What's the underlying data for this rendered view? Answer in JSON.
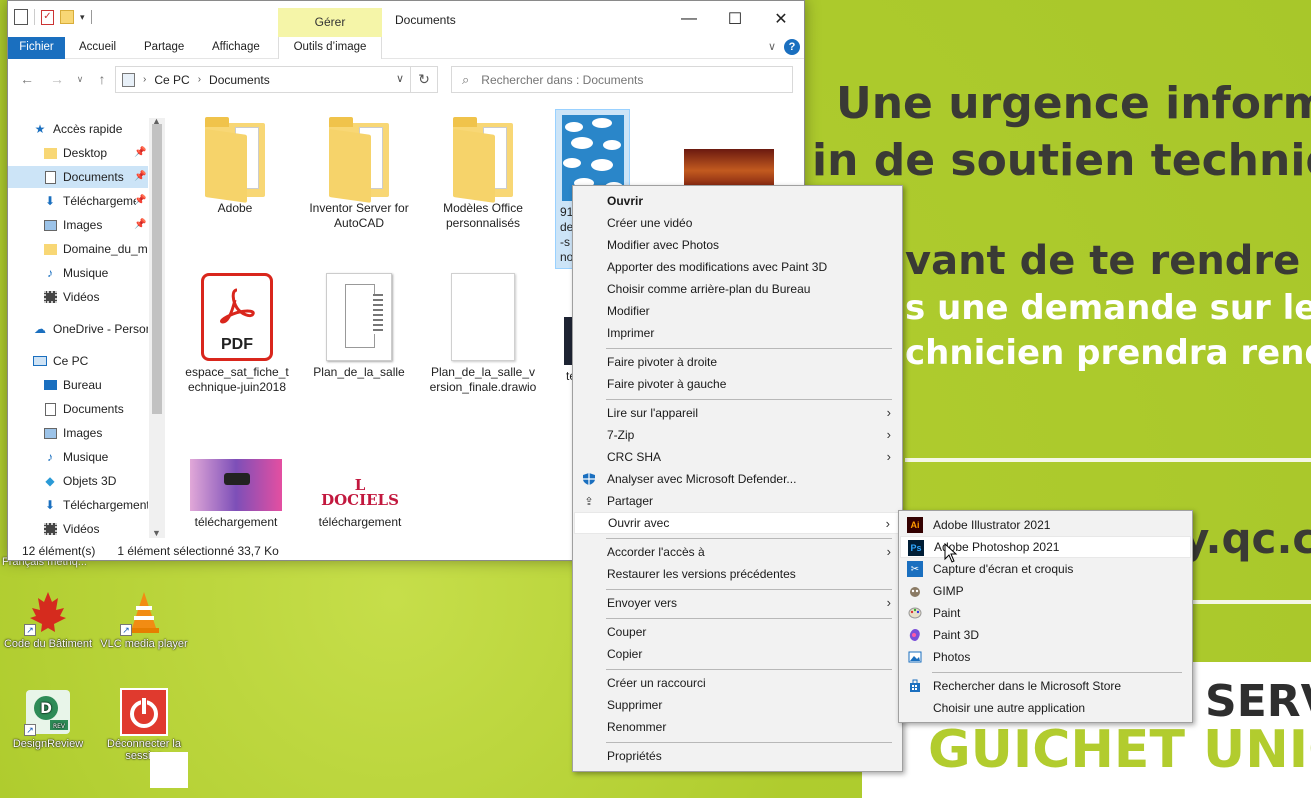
{
  "wallpaper": {
    "line1": "Une urgence inform",
    "line2": "in de soutien techniq",
    "line3_bold": "vant",
    "line3_rest": " de te rendre c",
    "line4": "s une demande sur le p",
    "line5": "chnicien prendra rende",
    "line6": "y.qc.c",
    "line7": "SERV",
    "line8": "GUICHET UNIO",
    "hidden_label": "Français méthq..."
  },
  "desktop_icons": [
    {
      "label": "Code du Bâtiment"
    },
    {
      "label": "VLC media player"
    },
    {
      "label": "DesignReview"
    },
    {
      "label": "Déconnecter la session"
    }
  ],
  "window": {
    "title": "Documents",
    "manage_tab": "Gérer",
    "ribbon_tabs": [
      "Fichier",
      "Accueil",
      "Partage",
      "Affichage",
      "Outils d’image"
    ],
    "breadcrumb": [
      "Ce PC",
      "Documents"
    ],
    "search_placeholder": "Rechercher dans : Documents",
    "nav": {
      "quick_access": "Accès rapide",
      "items": [
        "Desktop",
        "Documents",
        "Téléchargements",
        "Images",
        "Domaine_du_mu",
        "Musique",
        "Vidéos"
      ],
      "onedrive": "OneDrive - Person",
      "this_pc": "Ce PC",
      "pc_items": [
        "Bureau",
        "Documents",
        "Images",
        "Musique",
        "Objets 3D",
        "Téléchargements",
        "Vidéos"
      ]
    },
    "files": [
      {
        "name": "Adobe",
        "type": "folder"
      },
      {
        "name": "Inventor Server for AutoCAD",
        "type": "folder"
      },
      {
        "name": "Modèles Office personnalisés",
        "type": "folder"
      },
      {
        "name": "91\nde\n-s\nno",
        "type": "image-selected"
      },
      {
        "name": "",
        "type": "image"
      },
      {
        "name": "espace_sat_fiche_technique-juin2018",
        "type": "pdf",
        "badge": "PDF"
      },
      {
        "name": "Plan_de_la_salle",
        "type": "doc"
      },
      {
        "name": "Plan_de_la_salle_version_finale.drawio",
        "type": "blank"
      },
      {
        "name": "te",
        "type": "image"
      },
      {
        "name": "téléchargement",
        "type": "image"
      },
      {
        "name": "téléchargement",
        "type": "image-logo",
        "logo_text": "L DOCIELS"
      }
    ],
    "status": {
      "count": "12 élément(s)",
      "selection": "1 élément sélectionné  33,7 Ko"
    }
  },
  "context_menu": {
    "groups": [
      [
        "Ouvrir",
        "Créer une vidéo",
        "Modifier avec Photos",
        "Apporter des modifications avec Paint 3D",
        "Choisir comme arrière-plan du Bureau",
        "Modifier",
        "Imprimer"
      ],
      [
        "Faire pivoter à droite",
        "Faire pivoter à gauche"
      ],
      [
        "Lire sur l'appareil",
        "7-Zip",
        "CRC SHA",
        "Analyser avec Microsoft Defender...",
        "Partager",
        "Ouvrir avec"
      ],
      [
        "Accorder l'accès à",
        "Restaurer les versions précédentes"
      ],
      [
        "Envoyer vers"
      ],
      [
        "Couper",
        "Copier"
      ],
      [
        "Créer un raccourci",
        "Supprimer",
        "Renommer"
      ],
      [
        "Propriétés"
      ]
    ]
  },
  "open_with_menu": {
    "items": [
      "Adobe Illustrator 2021",
      "Adobe Photoshop 2021",
      "Capture d'écran et croquis",
      "GIMP",
      "Paint",
      "Paint 3D",
      "Photos"
    ],
    "extra": [
      "Rechercher dans le Microsoft Store",
      "Choisir une autre application"
    ],
    "highlighted": "Adobe Photoshop 2021"
  },
  "icons": {
    "ai_badge": "Ai",
    "ps_badge": "Ps"
  },
  "colors": {
    "accent": "#1a6fbf",
    "selection": "#cce4f7",
    "wallpaper": "#b7d33a",
    "manage_tab": "#f5f5a8"
  }
}
